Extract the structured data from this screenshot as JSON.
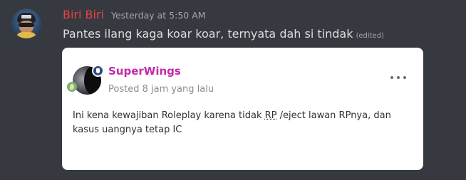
{
  "message": {
    "author": "Biri Biri",
    "timestamp": "Yesterday at 5:50 AM",
    "text": "Pantes  ilang kaga koar koar, ternyata dah si tindak",
    "edited_label": "(edited)"
  },
  "embed": {
    "poster_name": "SuperWings",
    "posted_time": "Posted 8 jam yang lalu",
    "body_before": "Ini kena kewajiban Roleplay karena tidak ",
    "body_abbr": "RP",
    "body_after": " /eject lawan RPnya, dan kasus uangnya tetap IC",
    "more_icon": "more-horizontal-icon",
    "badge_icon": "shield-icon"
  },
  "colors": {
    "background": "#36393f",
    "author": "#ed4245",
    "poster_name": "#c42ba8",
    "embed_background": "#ffffff"
  }
}
